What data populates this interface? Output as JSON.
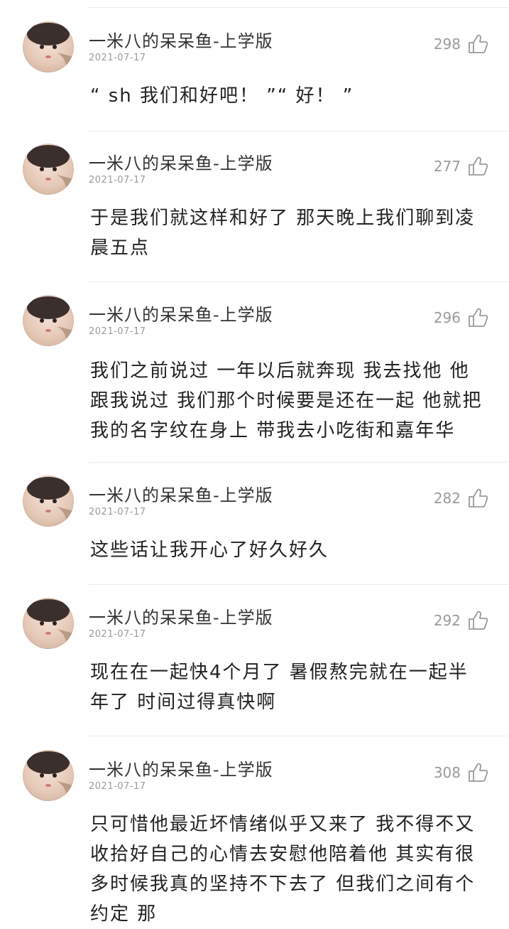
{
  "comments": [
    {
      "username": "一米八的呆呆鱼-上学版",
      "date": "2021-07-17",
      "likes": "298",
      "text": "“ sh 我们和好吧！ ”“ 好！ ”"
    },
    {
      "username": "一米八的呆呆鱼-上学版",
      "date": "2021-07-17",
      "likes": "277",
      "text": "于是我们就这样和好了 那天晚上我们聊到凌晨五点"
    },
    {
      "username": "一米八的呆呆鱼-上学版",
      "date": "2021-07-17",
      "likes": "296",
      "text": "我们之前说过 一年以后就奔现 我去找他 他跟我说过 我们那个时候要是还在一起 他就把我的名字纹在身上 带我去小吃街和嘉年华"
    },
    {
      "username": "一米八的呆呆鱼-上学版",
      "date": "2021-07-17",
      "likes": "282",
      "text": "这些话让我开心了好久好久"
    },
    {
      "username": "一米八的呆呆鱼-上学版",
      "date": "2021-07-17",
      "likes": "292",
      "text": "现在在一起快4个月了 暑假熬完就在一起半年了 时间过得真快啊"
    },
    {
      "username": "一米八的呆呆鱼-上学版",
      "date": "2021-07-17",
      "likes": "308",
      "text": "只可惜他最近坏情绪似乎又来了 我不得不又收拾好自己的心情去安慰他陪着他 其实有很多时候我真的坚持不下去了 但我们之间有个约定 那"
    }
  ]
}
